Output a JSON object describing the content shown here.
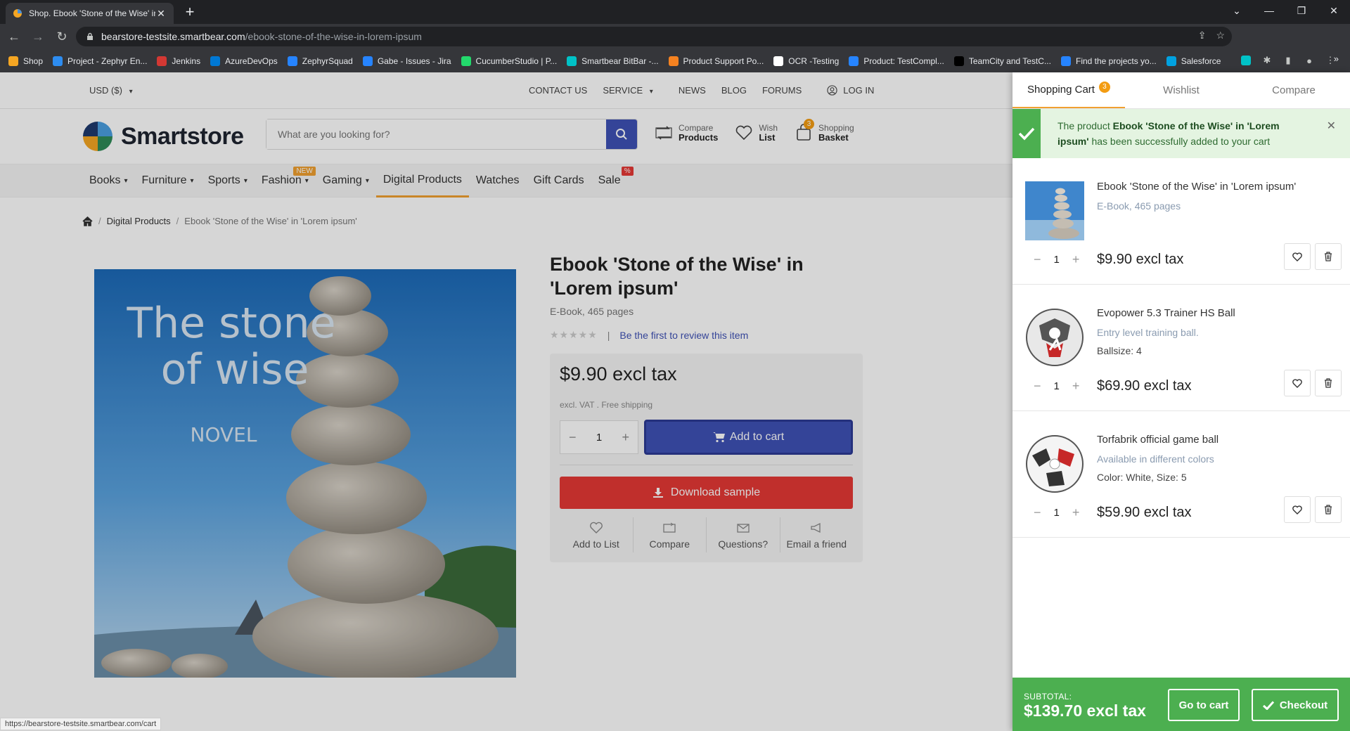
{
  "browser": {
    "tab_title": "Shop. Ebook 'Stone of the Wise' in",
    "url_host": "bearstore-testsite.smartbear.com",
    "url_path": "/ebook-stone-of-the-wise-in-lorem-ipsum",
    "bookmarks": [
      {
        "label": "Shop",
        "color": "#f5a623"
      },
      {
        "label": "Project - Zephyr En...",
        "color": "#2d8cf0"
      },
      {
        "label": "Jenkins",
        "color": "#d33833"
      },
      {
        "label": "AzureDevOps",
        "color": "#0078d4"
      },
      {
        "label": "ZephyrSquad",
        "color": "#2684ff"
      },
      {
        "label": "Gabe - Issues - Jira",
        "color": "#2684ff"
      },
      {
        "label": "CucumberStudio | P...",
        "color": "#23d96c"
      },
      {
        "label": "Smartbear BitBar -...",
        "color": "#00c2c7"
      },
      {
        "label": "Product Support Po...",
        "color": "#f58220"
      },
      {
        "label": "OCR -Testing",
        "color": "#ffffff"
      },
      {
        "label": "Product: TestCompl...",
        "color": "#2684ff"
      },
      {
        "label": "TeamCity and TestC...",
        "color": "#000000"
      },
      {
        "label": "Find the projects yo...",
        "color": "#2684ff"
      },
      {
        "label": "Salesforce",
        "color": "#00a1e0"
      }
    ],
    "status_url": "https://bearstore-testsite.smartbear.com/cart"
  },
  "topbar": {
    "currency": "USD ($)",
    "contact": "Contact us",
    "service": "Service",
    "news": "News",
    "blog": "Blog",
    "forums": "Forums",
    "login": "Log in"
  },
  "header": {
    "logo": "Smartstore",
    "search_placeholder": "What are you looking for?",
    "compare_top": "Compare",
    "compare_bottom": "Products",
    "wish_top": "Wish",
    "wish_bottom": "List",
    "basket_top": "Shopping",
    "basket_bottom": "Basket",
    "basket_count": "3"
  },
  "nav": {
    "items": [
      {
        "label": "Books",
        "dropdown": true
      },
      {
        "label": "Furniture",
        "dropdown": true
      },
      {
        "label": "Sports",
        "dropdown": true
      },
      {
        "label": "Fashion",
        "dropdown": true
      },
      {
        "label": "Gaming",
        "dropdown": true
      },
      {
        "label": "Digital Products",
        "dropdown": false
      },
      {
        "label": "Watches",
        "dropdown": false
      },
      {
        "label": "Gift Cards",
        "dropdown": false
      },
      {
        "label": "Sale",
        "dropdown": false
      }
    ],
    "new_flag": "NEW",
    "sale_flag": "%"
  },
  "breadcrumb": {
    "category": "Digital Products",
    "current": "Ebook 'Stone of the Wise' in 'Lorem ipsum'"
  },
  "cover": {
    "line1": "The stone",
    "line2": "of wise",
    "genre": "NOVEL"
  },
  "product": {
    "title": "Ebook 'Stone of the Wise' in 'Lorem ipsum'",
    "subtitle": "E-Book, 465 pages",
    "review_link": "Be the first to review this item",
    "price": "$9.90 excl tax",
    "vat_note": "excl. VAT . Free shipping",
    "qty": "1",
    "add_to_cart": "Add to cart",
    "download_sample": "Download sample",
    "actions": [
      "Add to List",
      "Compare",
      "Questions?",
      "Email a friend"
    ]
  },
  "cart": {
    "tabs": [
      "Shopping Cart",
      "Wishlist",
      "Compare"
    ],
    "cart_count": "3",
    "notice_pre": "The product ",
    "notice_product": "Ebook 'Stone of the Wise' in 'Lorem ipsum'",
    "notice_post": " has been successfully added to your cart",
    "items": [
      {
        "name": "Ebook 'Stone of the Wise' in 'Lorem ipsum'",
        "desc": "E-Book, 465 pages",
        "attr": "",
        "qty": "1",
        "price": "$9.90 excl tax"
      },
      {
        "name": "Evopower 5.3 Trainer HS Ball",
        "desc": "Entry level training ball.",
        "attr": "Ballsize: 4",
        "qty": "1",
        "price": "$69.90 excl tax"
      },
      {
        "name": "Torfabrik official game ball",
        "desc": "Available in different colors",
        "attr": "Color: White, Size: 5",
        "qty": "1",
        "price": "$59.90 excl tax"
      }
    ],
    "subtotal_label": "SUBTOTAL:",
    "subtotal": "$139.70 excl tax",
    "go_to_cart": "Go to cart",
    "checkout": "Checkout"
  },
  "colors": {
    "primary": "#3f51b5",
    "danger": "#e53935",
    "success": "#4caf50",
    "accent": "#f0a030"
  }
}
